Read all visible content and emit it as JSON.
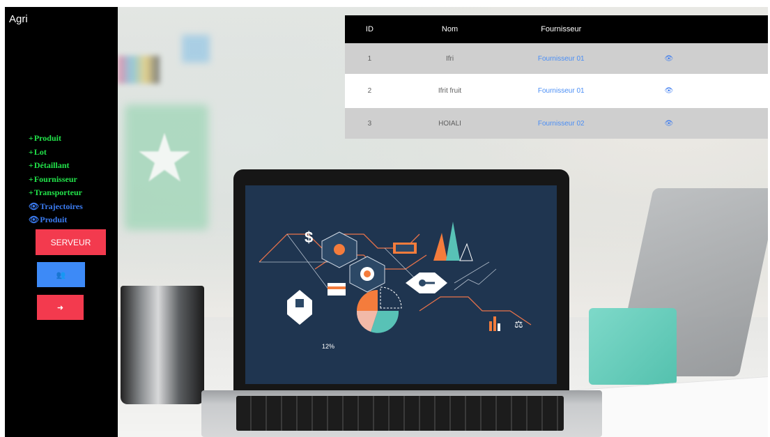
{
  "app": {
    "brand": "Agri"
  },
  "sidebar": {
    "items": [
      {
        "icon": "plus-icon",
        "glyph": "+",
        "label": "Produit",
        "color": "#22e34a"
      },
      {
        "icon": "plus-icon",
        "glyph": "+",
        "label": "Lot",
        "color": "#22e34a"
      },
      {
        "icon": "plus-icon",
        "glyph": "+",
        "label": "Détaillant",
        "color": "#22e34a"
      },
      {
        "icon": "plus-icon",
        "glyph": "+",
        "label": "Fournisseur",
        "color": "#22e34a"
      },
      {
        "icon": "plus-icon",
        "glyph": "+",
        "label": "Transporteur",
        "color": "#22e34a"
      },
      {
        "icon": "eye-icon",
        "glyph": "👁",
        "label": "Trajectoires",
        "color": "#3b7bf0"
      },
      {
        "icon": "eye-icon",
        "glyph": "👁",
        "label": "Produit",
        "color": "#3b7bf0"
      }
    ],
    "buttons": {
      "serveur": {
        "label": "SERVEUR",
        "color": "#f33a4e"
      },
      "users": {
        "icon": "users-icon",
        "glyph": "👥",
        "color": "#3d8af7"
      },
      "logout": {
        "icon": "sign-out-icon",
        "glyph": "➜",
        "color": "#f33a4e"
      }
    }
  },
  "table": {
    "headers": {
      "id": "ID",
      "nom": "Nom",
      "fournisseur": "Fournisseur"
    },
    "rows": [
      {
        "id": "1",
        "nom": "Ifri",
        "fournisseur": "Fournisseur 01",
        "action_icon": "eye-icon"
      },
      {
        "id": "2",
        "nom": "Ifrit fruit",
        "fournisseur": "Fournisseur 01",
        "action_icon": "eye-icon"
      },
      {
        "id": "3",
        "nom": "HOIALI",
        "fournisseur": "Fournisseur 02",
        "action_icon": "eye-icon"
      }
    ]
  },
  "background": {
    "screen_caption": "12%",
    "dollar_glyph": "$"
  },
  "colors": {
    "sidebar_bg": "#000000",
    "accent_green": "#22e34a",
    "accent_blue": "#3b7bf0",
    "danger": "#f33a4e",
    "link": "#4a8ef5",
    "row_grey": "#cfcfcf"
  }
}
